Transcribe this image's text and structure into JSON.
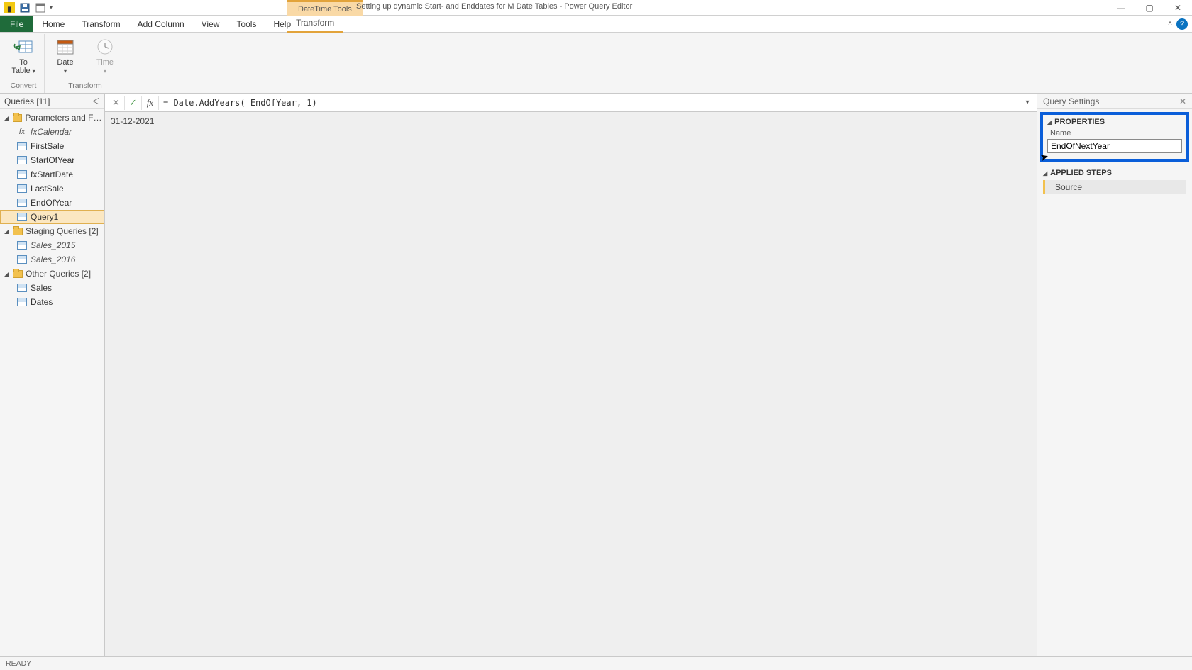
{
  "title_bar": {
    "contextual_tab_group": "DateTime Tools",
    "document_title": "Setting up dynamic Start- and Enddates for M Date Tables - Power Query Editor"
  },
  "ribbon_tabs": {
    "file": "File",
    "home": "Home",
    "transform": "Transform",
    "add_column": "Add Column",
    "view": "View",
    "tools": "Tools",
    "help": "Help",
    "ctx_transform": "Transform"
  },
  "ribbon": {
    "to_table": {
      "label1": "To",
      "label2": "Table"
    },
    "date": {
      "label": "Date"
    },
    "time": {
      "label": "Time"
    },
    "group_convert": "Convert",
    "group_transform": "Transform"
  },
  "queries_pane": {
    "header": "Queries [11]",
    "groups": [
      {
        "label": "Parameters and Fu…",
        "items": [
          {
            "label": "fxCalendar",
            "icon": "fx",
            "italic": true
          },
          {
            "label": "FirstSale",
            "icon": "table"
          },
          {
            "label": "StartOfYear",
            "icon": "table"
          },
          {
            "label": "fxStartDate",
            "icon": "table"
          },
          {
            "label": "LastSale",
            "icon": "table"
          },
          {
            "label": "EndOfYear",
            "icon": "table"
          },
          {
            "label": "Query1",
            "icon": "table",
            "selected": true
          }
        ]
      },
      {
        "label": "Staging Queries [2]",
        "items": [
          {
            "label": "Sales_2015",
            "icon": "table",
            "italic": true
          },
          {
            "label": "Sales_2016",
            "icon": "table",
            "italic": true
          }
        ]
      },
      {
        "label": "Other Queries [2]",
        "items": [
          {
            "label": "Sales",
            "icon": "table"
          },
          {
            "label": "Dates",
            "icon": "table"
          }
        ]
      }
    ]
  },
  "formula_bar": {
    "formula": "= Date.AddYears( EndOfYear, 1)"
  },
  "data_area": {
    "value": "31-12-2021"
  },
  "settings": {
    "header": "Query Settings",
    "properties_title": "PROPERTIES",
    "name_label": "Name",
    "name_value": "EndOfNextYear",
    "applied_steps_title": "APPLIED STEPS",
    "steps": [
      "Source"
    ]
  },
  "status_bar": {
    "ready": "READY"
  }
}
